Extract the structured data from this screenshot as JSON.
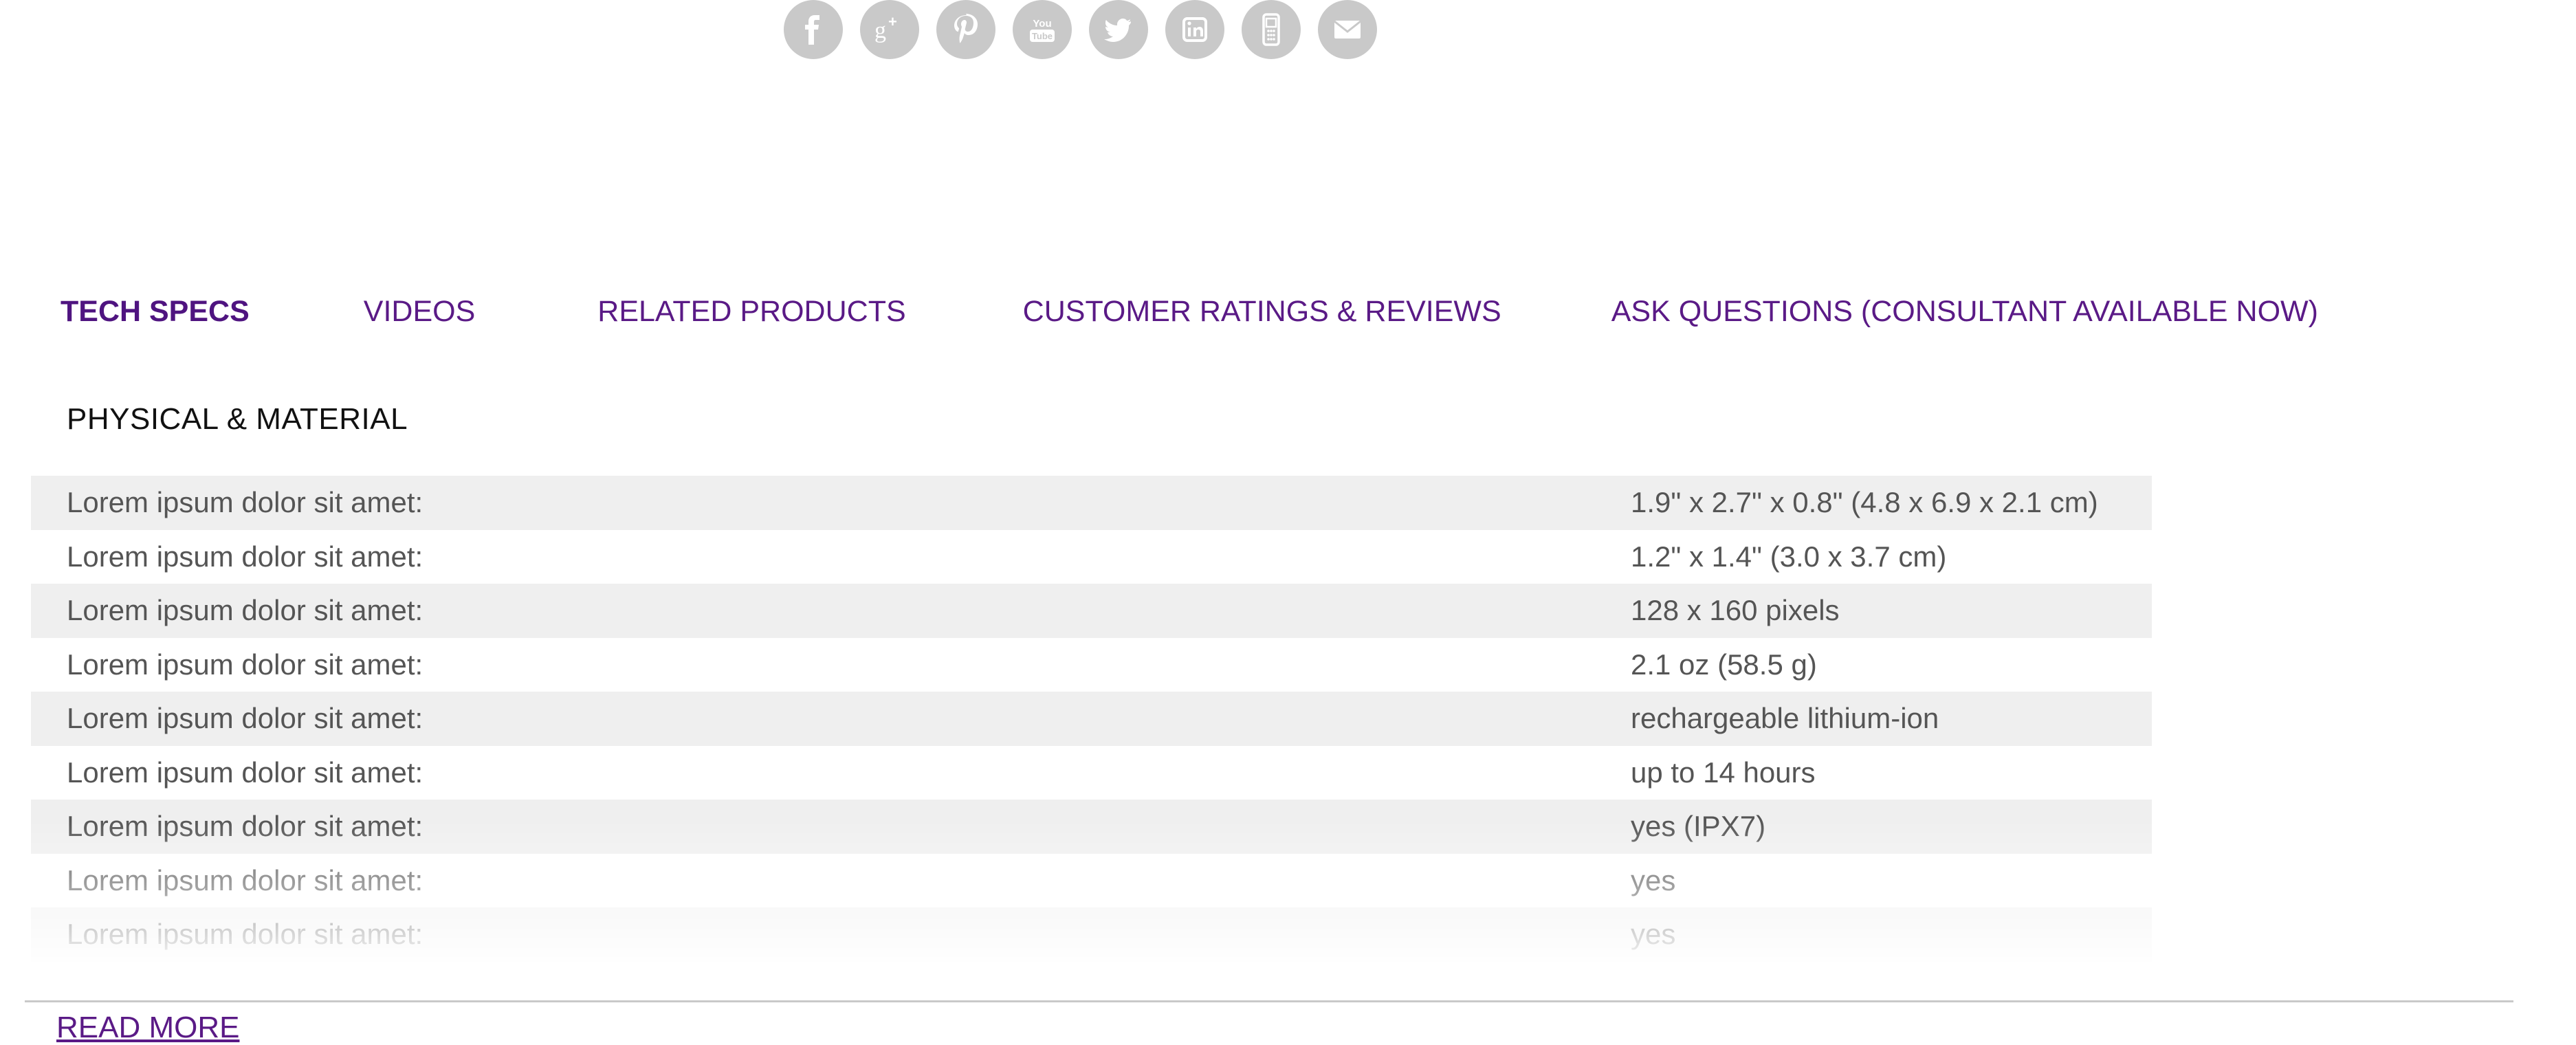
{
  "social": [
    {
      "name": "facebook-icon",
      "glyph": "f"
    },
    {
      "name": "google-plus-icon",
      "glyph": "g+"
    },
    {
      "name": "pinterest-icon",
      "glyph": "p"
    },
    {
      "name": "youtube-icon",
      "glyph": "You Tube"
    },
    {
      "name": "twitter-icon",
      "glyph": "bird"
    },
    {
      "name": "linkedin-icon",
      "glyph": "in"
    },
    {
      "name": "phone-icon",
      "glyph": "mobile"
    },
    {
      "name": "email-icon",
      "glyph": "envelope"
    }
  ],
  "tabs": [
    {
      "label": "TECH SPECS",
      "active": true
    },
    {
      "label": "VIDEOS",
      "active": false
    },
    {
      "label": "RELATED PRODUCTS",
      "active": false
    },
    {
      "label": "CUSTOMER RATINGS & REVIEWS",
      "active": false
    },
    {
      "label": "ASK QUESTIONS (CONSULTANT AVAILABLE NOW)",
      "active": false
    }
  ],
  "section_title": "PHYSICAL & MATERIAL",
  "specs": [
    {
      "label": "Lorem ipsum dolor sit amet:",
      "value": "1.9\" x 2.7\" x 0.8\" (4.8 x 6.9 x 2.1 cm)"
    },
    {
      "label": "Lorem ipsum dolor sit amet:",
      "value": "1.2\" x 1.4\" (3.0 x 3.7 cm)"
    },
    {
      "label": "Lorem ipsum dolor sit amet:",
      "value": "128 x 160 pixels"
    },
    {
      "label": "Lorem ipsum dolor sit amet:",
      "value": "2.1 oz (58.5 g)"
    },
    {
      "label": "Lorem ipsum dolor sit amet:",
      "value": "rechargeable lithium-ion"
    },
    {
      "label": "Lorem ipsum dolor sit amet:",
      "value": "up to 14 hours"
    },
    {
      "label": "Lorem ipsum dolor sit amet:",
      "value": "yes (IPX7)"
    },
    {
      "label": "Lorem ipsum dolor sit amet:",
      "value": "yes"
    },
    {
      "label": "Lorem ipsum dolor sit amet:",
      "value": "yes"
    }
  ],
  "read_more": "READ MORE",
  "colors": {
    "accent": "#5a1a86",
    "icon_bg": "#c9c9c9",
    "row_stripe": "#efefef",
    "text": "#555555"
  }
}
